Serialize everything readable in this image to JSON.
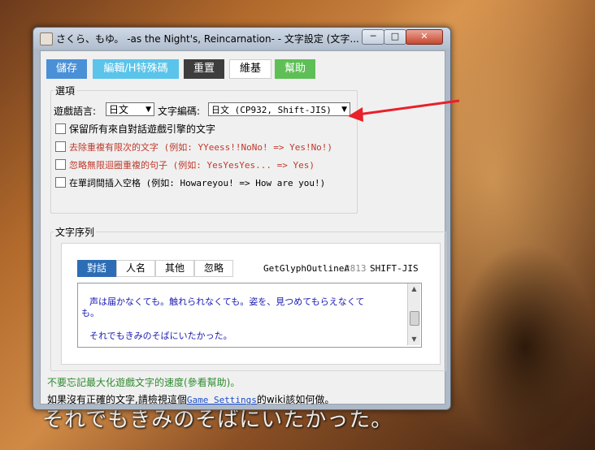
{
  "window": {
    "title": "さくら、もゆ。 -as the Night's, Reincarnation- - 文字設定 (文字...",
    "min_glyph": "─",
    "max_glyph": "□",
    "close_glyph": "✕"
  },
  "toolbar": {
    "save": "儲存",
    "edit_codes": "編輯/H特殊碼",
    "reset": "重置",
    "maintain": "維基",
    "help": "幫助"
  },
  "options": {
    "group_label": "選項",
    "game_language_label": "遊戲語言:",
    "game_language_value": "日文",
    "text_encoding_label": "文字編碼:",
    "text_encoding_value": "日文 (CP932, Shift-JIS)",
    "keep_all_text": "保留所有來自對話遊戲引擎的文字",
    "remove_finite_repeat": "去除重複有限次的文字 (例如: YYeess!!NoNo! => Yes!No!)",
    "ignore_infinite_repeat": "忽略無限迴圈重複的句子 (例如: YesYesYes... => Yes)",
    "insert_spaces": "在單詞間插入空格 (例如: Howareyou! => How are you!)"
  },
  "sequence": {
    "group_label": "文字序列",
    "tabs": [
      "對話",
      "人名",
      "其他",
      "忽略"
    ],
    "function_name": "GetGlyphOutlineA",
    "function_count": "2813",
    "function_encoding": "SHIFT-JIS",
    "text_line1": "声は届かなくても。触れられなくても。姿を、見つめてもらえなくて",
    "text_line1b": "も。",
    "text_line2": "それでもきみのそばにいたかった。"
  },
  "footer": {
    "tip": "不要忘記最大化遊戲文字的速度(參看幫助)。",
    "note_prefix": "如果沒有正確的文字,請檢視這個",
    "note_link": "Game Settings",
    "note_suffix": "的wiki該如何做。"
  },
  "background": {
    "subtitle": "それでもきみのそばにいたかった。"
  }
}
